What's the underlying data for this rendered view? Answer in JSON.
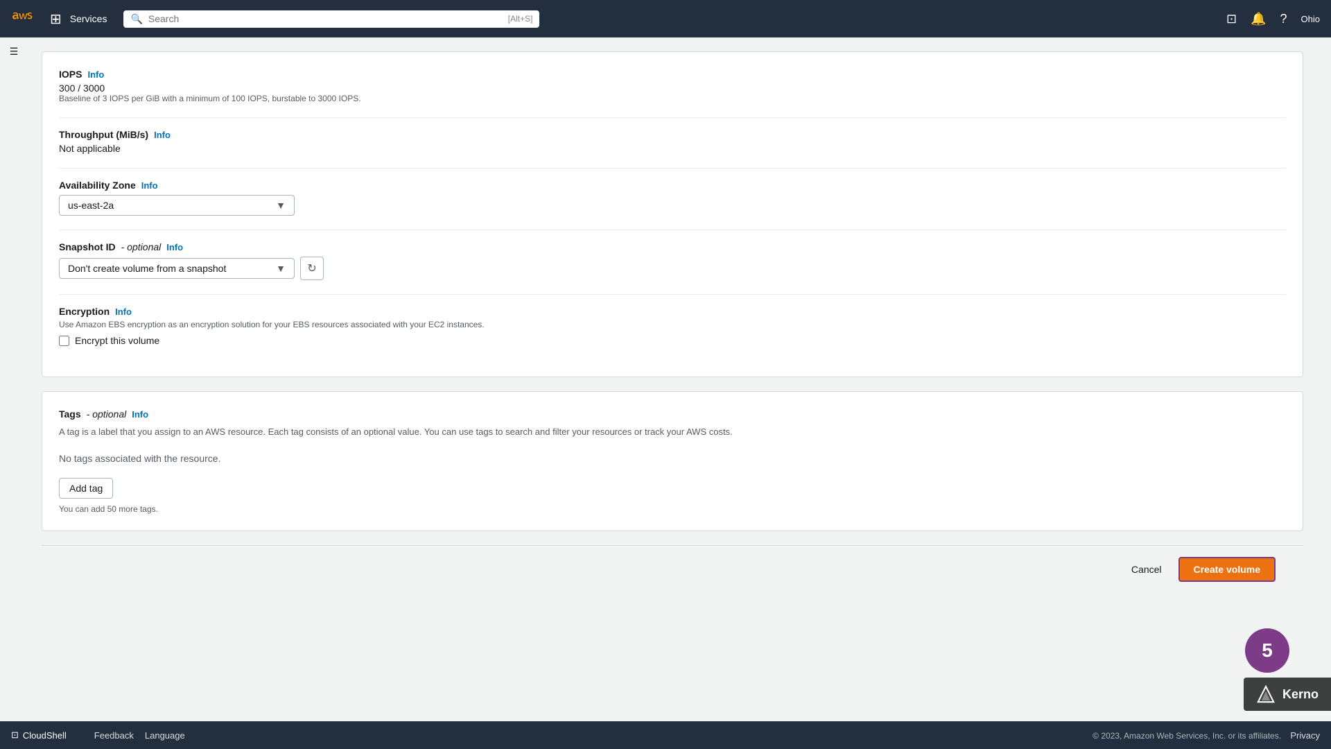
{
  "topNav": {
    "services_label": "Services",
    "search_placeholder": "Search",
    "search_shortcut": "[Alt+S]",
    "region": "Ohio"
  },
  "iops": {
    "label": "IOPS",
    "info_label": "Info",
    "value": "300 / 3000",
    "hint": "Baseline of 3 IOPS per GiB with a minimum of 100 IOPS, burstable to 3000 IOPS."
  },
  "throughput": {
    "label": "Throughput (MiB/s)",
    "info_label": "Info",
    "value": "Not applicable"
  },
  "availability_zone": {
    "label": "Availability Zone",
    "info_label": "Info",
    "selected": "us-east-2a"
  },
  "snapshot_id": {
    "label": "Snapshot ID",
    "optional_label": "- optional",
    "info_label": "Info",
    "selected": "Don't create volume from a snapshot"
  },
  "encryption": {
    "label": "Encryption",
    "info_label": "Info",
    "description": "Use Amazon EBS encryption as an encryption solution for your EBS resources associated with your EC2 instances.",
    "checkbox_label": "Encrypt this volume",
    "checked": false
  },
  "tags": {
    "label": "Tags",
    "optional_label": "- optional",
    "info_label": "Info",
    "description": "A tag is a label that you assign to an AWS resource. Each tag consists of an optional value. You can use tags to search and filter your resources or track your AWS costs.",
    "no_tags_msg": "No tags associated with the resource.",
    "add_tag_label": "Add tag",
    "footer_hint": "You can add 50 more tags."
  },
  "actions": {
    "cancel_label": "Cancel",
    "create_volume_label": "Create volume"
  },
  "footer": {
    "cloudshell_label": "CloudShell",
    "feedback_label": "Feedback",
    "language_label": "Language",
    "copyright": "© 2023, Amazon Web Services, Inc. or its affiliates.",
    "privacy_label": "Privacy"
  },
  "step_badge": "5",
  "kerno_label": "Kerno",
  "icons": {
    "search": "🔍",
    "grid": "⊞",
    "bell": "🔔",
    "help": "?",
    "cloudshell": "⊡",
    "refresh": "↻",
    "chevron_down": "▼"
  }
}
